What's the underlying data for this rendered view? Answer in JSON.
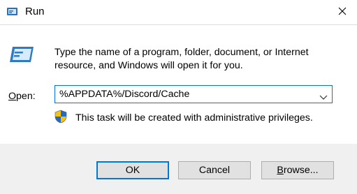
{
  "titlebar": {
    "title": "Run",
    "app_icon": "run-dialog-icon",
    "close_icon": "close-icon"
  },
  "dialog": {
    "icon": "run-program-icon",
    "description": "Type the name of a program, folder, document, or Internet resource, and Windows will open it for you.",
    "open_label_underlined": "O",
    "open_label_rest": "pen:",
    "open_value": "%APPDATA%/Discord/Cache",
    "admin_text": "This task will be created with administrative privileges.",
    "shield_icon": "uac-shield-icon"
  },
  "buttons": {
    "ok": "OK",
    "cancel": "Cancel",
    "browse_underlined": "B",
    "browse_rest": "rowse..."
  },
  "colors": {
    "accent": "#0078d7",
    "footer_bg": "#f0f0f0"
  }
}
